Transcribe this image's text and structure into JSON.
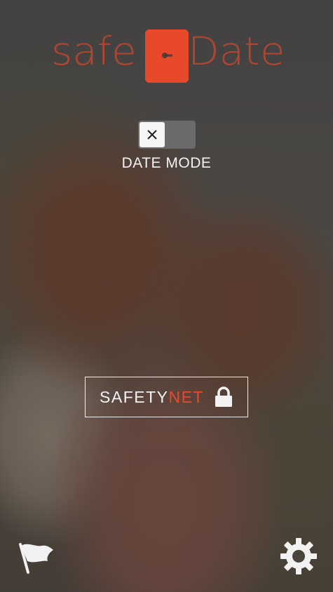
{
  "logo": {
    "left_text": "safe",
    "right_text": "Date",
    "brand_color": "#e8492b"
  },
  "date_mode": {
    "label": "DATE MODE",
    "state": "off",
    "knob_icon": "close-icon"
  },
  "safety_net": {
    "label_part1": "SAFETY",
    "label_part2": "NET",
    "icon": "lock-icon"
  },
  "bottom_bar": {
    "left_icon": "flag-icon",
    "right_icon": "gear-icon"
  },
  "colors": {
    "accent": "#e8492b",
    "text": "#f2f2f2",
    "toggle_track": "#6a6a6a"
  }
}
